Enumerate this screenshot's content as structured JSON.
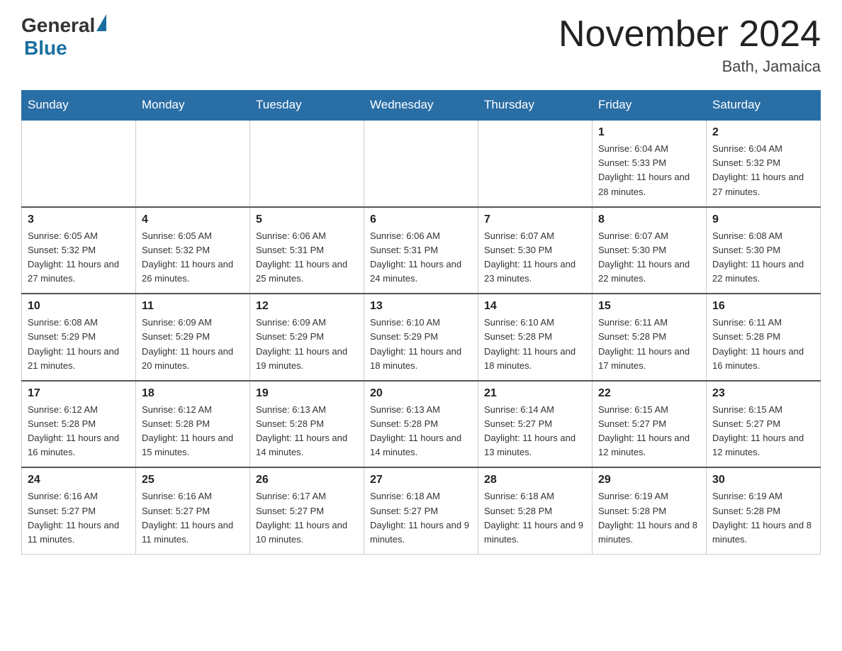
{
  "logo": {
    "text_general": "General",
    "text_blue": "Blue"
  },
  "header": {
    "month_year": "November 2024",
    "location": "Bath, Jamaica"
  },
  "days_of_week": [
    "Sunday",
    "Monday",
    "Tuesday",
    "Wednesday",
    "Thursday",
    "Friday",
    "Saturday"
  ],
  "weeks": [
    [
      {
        "day": "",
        "sunrise": "",
        "sunset": "",
        "daylight": ""
      },
      {
        "day": "",
        "sunrise": "",
        "sunset": "",
        "daylight": ""
      },
      {
        "day": "",
        "sunrise": "",
        "sunset": "",
        "daylight": ""
      },
      {
        "day": "",
        "sunrise": "",
        "sunset": "",
        "daylight": ""
      },
      {
        "day": "",
        "sunrise": "",
        "sunset": "",
        "daylight": ""
      },
      {
        "day": "1",
        "sunrise": "Sunrise: 6:04 AM",
        "sunset": "Sunset: 5:33 PM",
        "daylight": "Daylight: 11 hours and 28 minutes."
      },
      {
        "day": "2",
        "sunrise": "Sunrise: 6:04 AM",
        "sunset": "Sunset: 5:32 PM",
        "daylight": "Daylight: 11 hours and 27 minutes."
      }
    ],
    [
      {
        "day": "3",
        "sunrise": "Sunrise: 6:05 AM",
        "sunset": "Sunset: 5:32 PM",
        "daylight": "Daylight: 11 hours and 27 minutes."
      },
      {
        "day": "4",
        "sunrise": "Sunrise: 6:05 AM",
        "sunset": "Sunset: 5:32 PM",
        "daylight": "Daylight: 11 hours and 26 minutes."
      },
      {
        "day": "5",
        "sunrise": "Sunrise: 6:06 AM",
        "sunset": "Sunset: 5:31 PM",
        "daylight": "Daylight: 11 hours and 25 minutes."
      },
      {
        "day": "6",
        "sunrise": "Sunrise: 6:06 AM",
        "sunset": "Sunset: 5:31 PM",
        "daylight": "Daylight: 11 hours and 24 minutes."
      },
      {
        "day": "7",
        "sunrise": "Sunrise: 6:07 AM",
        "sunset": "Sunset: 5:30 PM",
        "daylight": "Daylight: 11 hours and 23 minutes."
      },
      {
        "day": "8",
        "sunrise": "Sunrise: 6:07 AM",
        "sunset": "Sunset: 5:30 PM",
        "daylight": "Daylight: 11 hours and 22 minutes."
      },
      {
        "day": "9",
        "sunrise": "Sunrise: 6:08 AM",
        "sunset": "Sunset: 5:30 PM",
        "daylight": "Daylight: 11 hours and 22 minutes."
      }
    ],
    [
      {
        "day": "10",
        "sunrise": "Sunrise: 6:08 AM",
        "sunset": "Sunset: 5:29 PM",
        "daylight": "Daylight: 11 hours and 21 minutes."
      },
      {
        "day": "11",
        "sunrise": "Sunrise: 6:09 AM",
        "sunset": "Sunset: 5:29 PM",
        "daylight": "Daylight: 11 hours and 20 minutes."
      },
      {
        "day": "12",
        "sunrise": "Sunrise: 6:09 AM",
        "sunset": "Sunset: 5:29 PM",
        "daylight": "Daylight: 11 hours and 19 minutes."
      },
      {
        "day": "13",
        "sunrise": "Sunrise: 6:10 AM",
        "sunset": "Sunset: 5:29 PM",
        "daylight": "Daylight: 11 hours and 18 minutes."
      },
      {
        "day": "14",
        "sunrise": "Sunrise: 6:10 AM",
        "sunset": "Sunset: 5:28 PM",
        "daylight": "Daylight: 11 hours and 18 minutes."
      },
      {
        "day": "15",
        "sunrise": "Sunrise: 6:11 AM",
        "sunset": "Sunset: 5:28 PM",
        "daylight": "Daylight: 11 hours and 17 minutes."
      },
      {
        "day": "16",
        "sunrise": "Sunrise: 6:11 AM",
        "sunset": "Sunset: 5:28 PM",
        "daylight": "Daylight: 11 hours and 16 minutes."
      }
    ],
    [
      {
        "day": "17",
        "sunrise": "Sunrise: 6:12 AM",
        "sunset": "Sunset: 5:28 PM",
        "daylight": "Daylight: 11 hours and 16 minutes."
      },
      {
        "day": "18",
        "sunrise": "Sunrise: 6:12 AM",
        "sunset": "Sunset: 5:28 PM",
        "daylight": "Daylight: 11 hours and 15 minutes."
      },
      {
        "day": "19",
        "sunrise": "Sunrise: 6:13 AM",
        "sunset": "Sunset: 5:28 PM",
        "daylight": "Daylight: 11 hours and 14 minutes."
      },
      {
        "day": "20",
        "sunrise": "Sunrise: 6:13 AM",
        "sunset": "Sunset: 5:28 PM",
        "daylight": "Daylight: 11 hours and 14 minutes."
      },
      {
        "day": "21",
        "sunrise": "Sunrise: 6:14 AM",
        "sunset": "Sunset: 5:27 PM",
        "daylight": "Daylight: 11 hours and 13 minutes."
      },
      {
        "day": "22",
        "sunrise": "Sunrise: 6:15 AM",
        "sunset": "Sunset: 5:27 PM",
        "daylight": "Daylight: 11 hours and 12 minutes."
      },
      {
        "day": "23",
        "sunrise": "Sunrise: 6:15 AM",
        "sunset": "Sunset: 5:27 PM",
        "daylight": "Daylight: 11 hours and 12 minutes."
      }
    ],
    [
      {
        "day": "24",
        "sunrise": "Sunrise: 6:16 AM",
        "sunset": "Sunset: 5:27 PM",
        "daylight": "Daylight: 11 hours and 11 minutes."
      },
      {
        "day": "25",
        "sunrise": "Sunrise: 6:16 AM",
        "sunset": "Sunset: 5:27 PM",
        "daylight": "Daylight: 11 hours and 11 minutes."
      },
      {
        "day": "26",
        "sunrise": "Sunrise: 6:17 AM",
        "sunset": "Sunset: 5:27 PM",
        "daylight": "Daylight: 11 hours and 10 minutes."
      },
      {
        "day": "27",
        "sunrise": "Sunrise: 6:18 AM",
        "sunset": "Sunset: 5:27 PM",
        "daylight": "Daylight: 11 hours and 9 minutes."
      },
      {
        "day": "28",
        "sunrise": "Sunrise: 6:18 AM",
        "sunset": "Sunset: 5:28 PM",
        "daylight": "Daylight: 11 hours and 9 minutes."
      },
      {
        "day": "29",
        "sunrise": "Sunrise: 6:19 AM",
        "sunset": "Sunset: 5:28 PM",
        "daylight": "Daylight: 11 hours and 8 minutes."
      },
      {
        "day": "30",
        "sunrise": "Sunrise: 6:19 AM",
        "sunset": "Sunset: 5:28 PM",
        "daylight": "Daylight: 11 hours and 8 minutes."
      }
    ]
  ]
}
